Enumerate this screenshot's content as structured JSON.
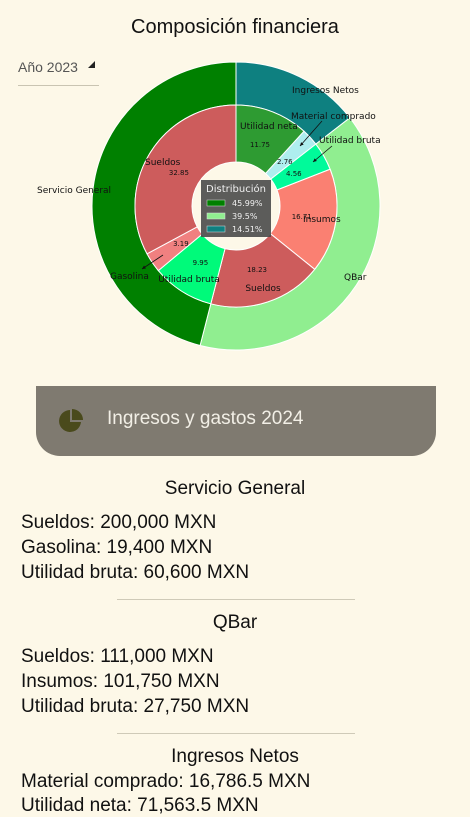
{
  "title": "Composición financiera",
  "year_select": {
    "value": "Año 2023"
  },
  "chart_data": {
    "type": "pie",
    "rings": [
      {
        "ring": "outer",
        "slices": [
          {
            "label": "Ingresos Netos",
            "value": 14.51,
            "color": "#0e8080"
          },
          {
            "label": "QBar",
            "value": 39.5,
            "color": "#90ee90"
          },
          {
            "label": "Servicio General",
            "value": 45.99,
            "color": "#008000"
          }
        ]
      },
      {
        "ring": "middle",
        "slices": [
          {
            "label": "Utilidad neta",
            "value": 11.75,
            "color": "#2e9b32",
            "group": "Ingresos Netos"
          },
          {
            "label": "Material comprado",
            "value": 2.76,
            "color": "#aeeeee",
            "group": "Ingresos Netos"
          },
          {
            "label": "Utilidad bruta",
            "value": 4.56,
            "color": "#00fa9a",
            "group": "QBar"
          },
          {
            "label": "Insumos",
            "value": 16.71,
            "color": "#fa8072",
            "group": "QBar"
          },
          {
            "label": "Sueldos",
            "value": 18.23,
            "color": "#cd5c5c",
            "group": "QBar"
          },
          {
            "label": "Utilidad bruta",
            "value": 9.95,
            "color": "#00fa7a",
            "group": "Servicio General"
          },
          {
            "label": "Gasolina",
            "value": 3.19,
            "color": "#f08080",
            "group": "Servicio General"
          },
          {
            "label": "Sueldos",
            "value": 32.85,
            "color": "#cd5c5c",
            "group": "Servicio General"
          }
        ]
      }
    ],
    "legend": {
      "title": "Distribución",
      "placement": "center",
      "entries": [
        {
          "label": "45.99%",
          "color": "#008000"
        },
        {
          "label": "39.5%",
          "color": "#90ee90"
        },
        {
          "label": "14.51%",
          "color": "#0e8080"
        }
      ]
    }
  },
  "banner": {
    "label": "Ingresos y gastos 2024",
    "icon": "pie-chart-icon",
    "bg": "#7f7a70"
  },
  "sections": [
    {
      "title": "Servicio General",
      "lines": [
        "Sueldos: 200,000 MXN",
        "Gasolina: 19,400 MXN",
        "Utilidad bruta: 60,600 MXN"
      ]
    },
    {
      "title": "QBar",
      "lines": [
        "Sueldos: 111,000 MXN",
        "Insumos: 101,750 MXN",
        "Utilidad bruta: 27,750 MXN"
      ]
    },
    {
      "title": "Ingresos Netos",
      "lines": [
        "Material comprado: 16,786.5 MXN",
        "Utilidad neta: 71,563.5 MXN"
      ]
    }
  ]
}
